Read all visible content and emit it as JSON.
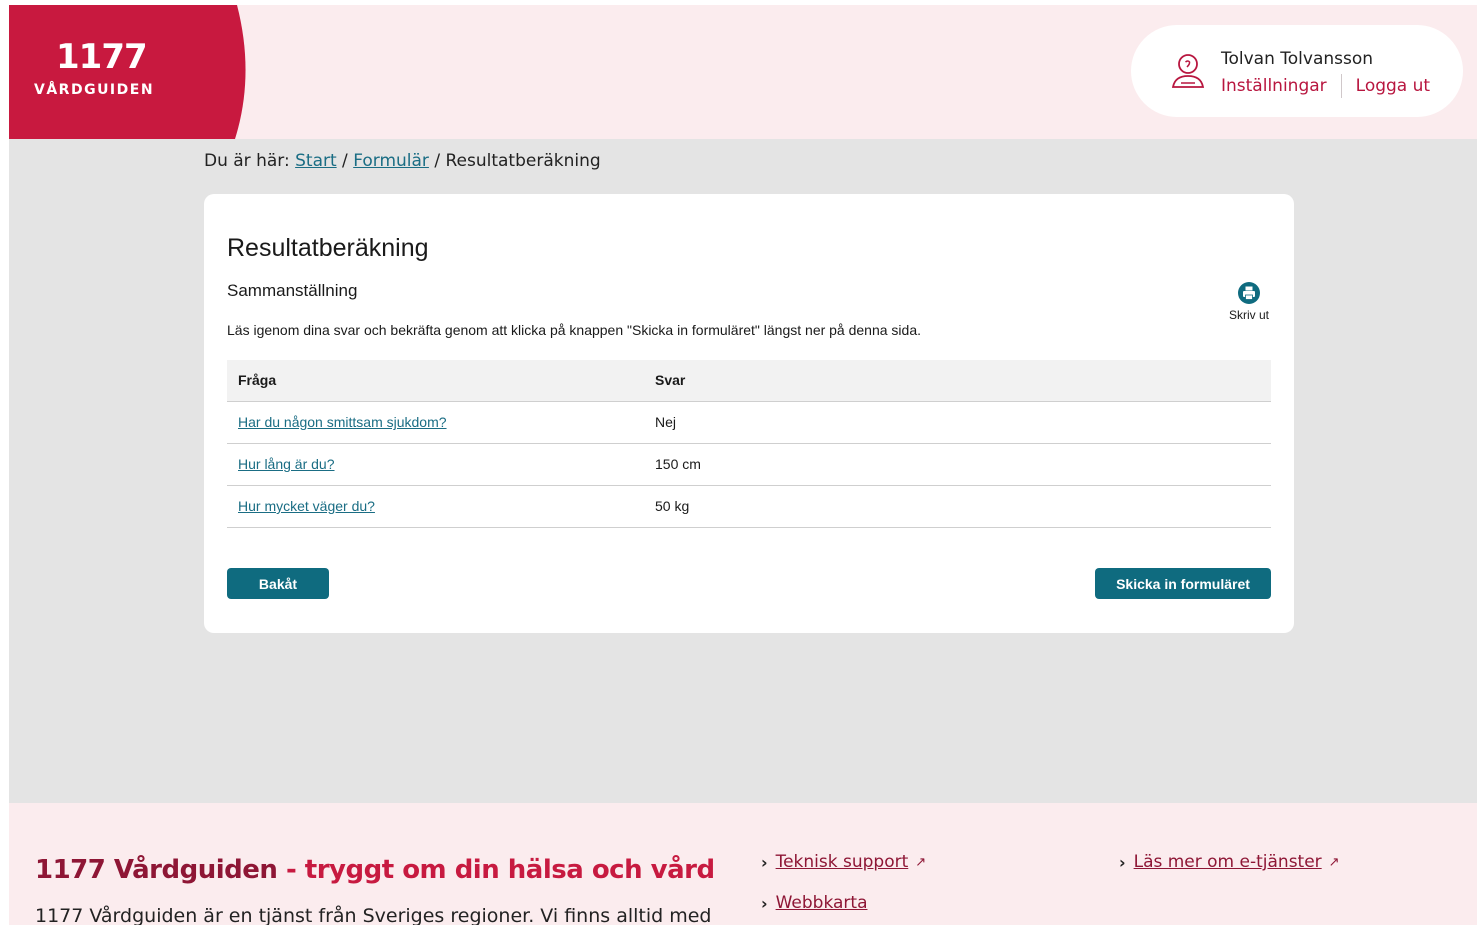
{
  "header": {
    "logo_number": "1177",
    "logo_text": "VÅRDGUIDEN",
    "user_name": "Tolvan Tolvansson",
    "settings_link": "Inställningar",
    "logout_link": "Logga ut"
  },
  "breadcrumb": {
    "prefix": "Du är här:",
    "start": "Start",
    "forms": "Formulär",
    "current": "Resultatberäkning",
    "separator": "/"
  },
  "card": {
    "title": "Resultatberäkning",
    "subtitle": "Sammanställning",
    "intro": "Läs igenom dina svar och bekräfta genom att klicka på knappen \"Skicka in formuläret\" längst ner på denna sida.",
    "print_label": "Skriv ut",
    "table": {
      "headers": [
        "Fråga",
        "Svar"
      ],
      "rows": [
        [
          "Har du någon smittsam sjukdom?",
          "Nej"
        ],
        [
          "Hur lång är du?",
          "150 cm"
        ],
        [
          "Hur mycket väger du?",
          "50 kg"
        ]
      ]
    },
    "back_button": "Bakåt",
    "submit_button": "Skicka in formuläret"
  },
  "footer": {
    "title_part1": "1177 Vårdguiden",
    "title_part2": " - tryggt om din hälsa och vård",
    "description": "1177 Vårdguiden är en tjänst från Sveriges regioner. Vi finns alltid med",
    "links": {
      "tech_support": "Teknisk support",
      "sitemap": "Webbkarta",
      "eservices": "Läs mer om e-tjänster"
    }
  },
  "colors": {
    "brand_red": "#c8193f",
    "header_bg": "#fbecee",
    "teal": "#0f6b7f",
    "page_bg": "#e4e4e4"
  }
}
